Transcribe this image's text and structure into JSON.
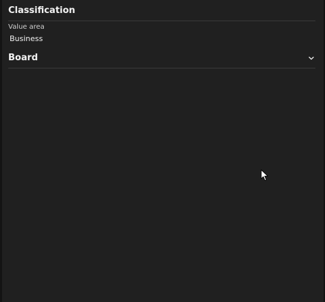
{
  "classification": {
    "title": "Classification",
    "value_area": {
      "label": "Value area",
      "value": "Business"
    }
  },
  "board": {
    "title": "Board",
    "expand_icon": "chevron-down-icon"
  },
  "colors": {
    "panel_background": "#202020",
    "text": "#f2f2f2",
    "divider": "#3a3a3a"
  }
}
